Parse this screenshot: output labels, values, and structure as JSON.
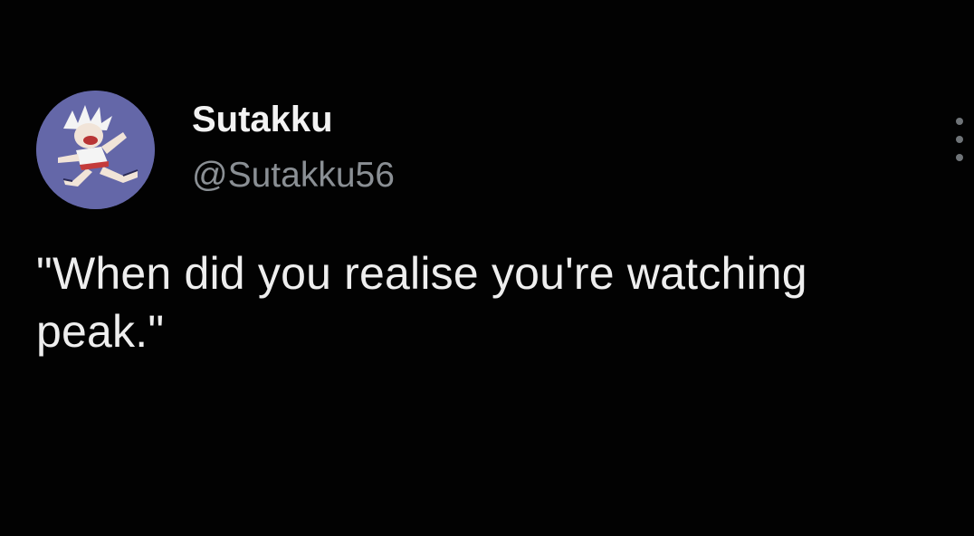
{
  "tweet": {
    "author": {
      "display_name": "Sutakku",
      "handle": "@Sutakku56",
      "avatar_icon": "cartoon-character-avatar"
    },
    "text": "\"When did you realise you're watching\npeak.\"",
    "more_icon": "vertical-ellipsis-icon"
  },
  "colors": {
    "background": "#000000",
    "text": "#eeeeee",
    "handle": "#8a8f94",
    "avatar_bg": "#6467a8"
  }
}
